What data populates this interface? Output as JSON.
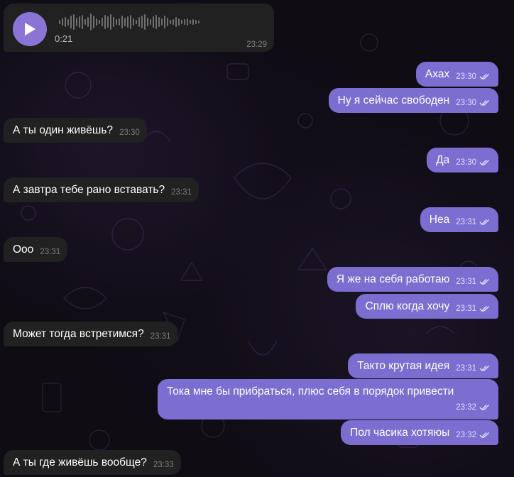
{
  "voice": {
    "duration": "0:21",
    "time": "23:29"
  },
  "messages": [
    {
      "id": "m1",
      "dir": "out",
      "text": "Ахах",
      "time": "23:30",
      "read": true
    },
    {
      "id": "m2",
      "dir": "out",
      "text": "Ну я сейчас свободен",
      "time": "23:30",
      "read": true
    },
    {
      "id": "m3",
      "dir": "in",
      "text": "А ты один живёшь?",
      "time": "23:30"
    },
    {
      "id": "m4",
      "dir": "out",
      "text": "Да",
      "time": "23:30",
      "read": true
    },
    {
      "id": "m5",
      "dir": "in",
      "text": "А завтра тебе рано вставать?",
      "time": "23:31"
    },
    {
      "id": "m6",
      "dir": "out",
      "text": "Неа",
      "time": "23:31",
      "read": true
    },
    {
      "id": "m7",
      "dir": "in",
      "text": "Ооо",
      "time": "23:31"
    },
    {
      "id": "m8",
      "dir": "out",
      "text": "Я же на себя работаю",
      "time": "23:31",
      "read": true
    },
    {
      "id": "m9",
      "dir": "out",
      "text": "Сплю когда хочу",
      "time": "23:31",
      "read": true
    },
    {
      "id": "m10",
      "dir": "in",
      "text": "Может тогда встретимся?",
      "time": "23:31"
    },
    {
      "id": "m11",
      "dir": "out",
      "text": "Такто крутая идея",
      "time": "23:31",
      "read": true
    },
    {
      "id": "m12",
      "dir": "out",
      "text": "Тока мне бы прибраться, плюс себя в порядок привести",
      "time": "23:32",
      "read": true
    },
    {
      "id": "m13",
      "dir": "out",
      "text": "Пол часика хотяюы",
      "time": "23:32",
      "read": true
    },
    {
      "id": "m14",
      "dir": "in",
      "text": "А ты где живёшь вообще?",
      "time": "23:33"
    }
  ],
  "colors": {
    "incoming": "#212121",
    "outgoing": "#7c6ed0",
    "accent": "#8a75d6",
    "background": "#0f0c14"
  }
}
